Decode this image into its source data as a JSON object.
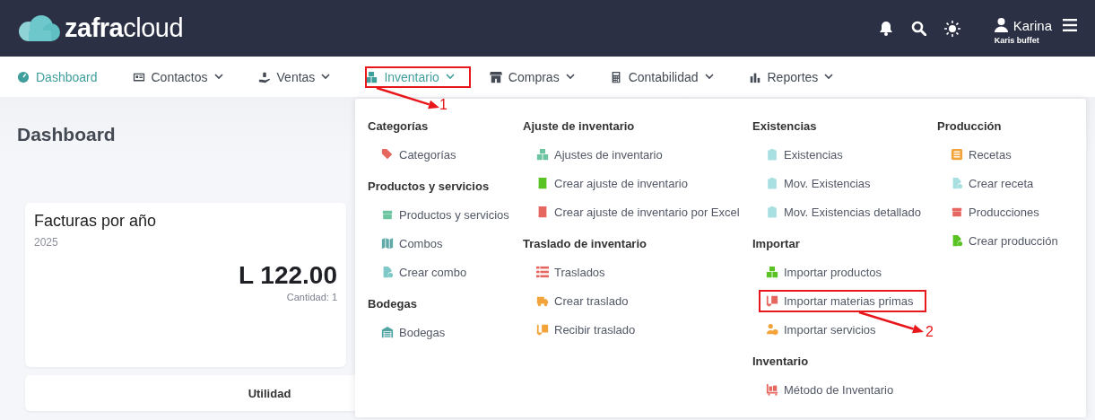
{
  "header": {
    "logo": {
      "bold": "zafra",
      "light": "cloud"
    },
    "user": {
      "name": "Karina",
      "company": "Karis buffet"
    }
  },
  "nav": [
    {
      "label": "Dashboard",
      "kind": "gauge",
      "selected": true,
      "dropdown": false
    },
    {
      "label": "Contactos",
      "kind": "card",
      "selected": false,
      "dropdown": true
    },
    {
      "label": "Ventas",
      "kind": "hand",
      "selected": false,
      "dropdown": true
    },
    {
      "label": "Inventario",
      "kind": "boxes",
      "selected": true,
      "dropdown": true
    },
    {
      "label": "Compras",
      "kind": "store",
      "selected": false,
      "dropdown": true
    },
    {
      "label": "Contabilidad",
      "kind": "calculator",
      "selected": false,
      "dropdown": true
    },
    {
      "label": "Reportes",
      "kind": "chart",
      "selected": false,
      "dropdown": true
    }
  ],
  "page": {
    "title": "Dashboard"
  },
  "cards": [
    {
      "kind": "stat",
      "title": "Facturas por año",
      "subtitle": "2025",
      "value": "L 122.00",
      "caption": "Cantidad: 1"
    },
    {
      "kind": "heading",
      "title": "Utilidad"
    }
  ],
  "menu": {
    "columns": [
      {
        "sections": [
          {
            "heading": "Categorías",
            "items": [
              {
                "label": "Categorías",
                "kind": "tag",
                "color": "#e5675f"
              }
            ]
          },
          {
            "heading": "Productos y servicios",
            "items": [
              {
                "label": "Productos y servicios",
                "kind": "box",
                "color": "#6cc4a1"
              },
              {
                "label": "Combos",
                "kind": "map",
                "color": "#5fa8a8"
              },
              {
                "label": "Crear combo",
                "kind": "file",
                "color": "#7fc8c8"
              }
            ]
          },
          {
            "heading": "Bodegas",
            "items": [
              {
                "label": "Bodegas",
                "kind": "warehouse",
                "color": "#4fa3a3"
              }
            ]
          }
        ]
      },
      {
        "sections": [
          {
            "heading": "Ajuste de inventario",
            "items": [
              {
                "label": "Ajustes de inventario",
                "kind": "boxes",
                "color": "#6cc4a1"
              },
              {
                "label": "Crear ajuste de inventario",
                "kind": "book",
                "color": "#58c322"
              },
              {
                "label": "Crear ajuste de inventario por Excel",
                "kind": "book",
                "color": "#e5675f"
              }
            ]
          },
          {
            "heading": "Traslado de inventario",
            "items": [
              {
                "label": "Traslados",
                "kind": "list",
                "color": "#e5675f"
              },
              {
                "label": "Crear traslado",
                "kind": "truck",
                "color": "#f2a33a"
              },
              {
                "label": "Recibir traslado",
                "kind": "dolly",
                "color": "#f2a33a"
              }
            ]
          }
        ]
      },
      {
        "sections": [
          {
            "heading": "Existencias",
            "items": [
              {
                "label": "Existencias",
                "kind": "clipboard",
                "color": "#a8dfe0"
              },
              {
                "label": "Mov. Existencias",
                "kind": "clipboard",
                "color": "#a8dfe0"
              },
              {
                "label": "Mov. Existencias detallado",
                "kind": "clipboard",
                "color": "#a8dfe0"
              }
            ]
          },
          {
            "heading": "Importar",
            "items": [
              {
                "label": "Importar productos",
                "kind": "boxes",
                "color": "#58c322"
              },
              {
                "label": "Importar materias primas",
                "kind": "dolly",
                "color": "#e5675f"
              },
              {
                "label": "Importar servicios",
                "kind": "user",
                "color": "#f2a33a"
              }
            ]
          },
          {
            "heading": "Inventario",
            "items": [
              {
                "label": "Método de Inventario",
                "kind": "cart",
                "color": "#e5675f"
              }
            ]
          }
        ]
      },
      {
        "sections": [
          {
            "heading": "Producción",
            "items": [
              {
                "label": "Recetas",
                "kind": "listbox",
                "color": "#f2a33a"
              },
              {
                "label": "Crear receta",
                "kind": "file",
                "color": "#a8dfe0"
              },
              {
                "label": "Producciones",
                "kind": "box",
                "color": "#e5675f"
              },
              {
                "label": "Crear producción",
                "kind": "file",
                "color": "#58c322"
              }
            ]
          }
        ]
      }
    ]
  },
  "annotations": [
    {
      "label": "1"
    },
    {
      "label": "2"
    }
  ]
}
